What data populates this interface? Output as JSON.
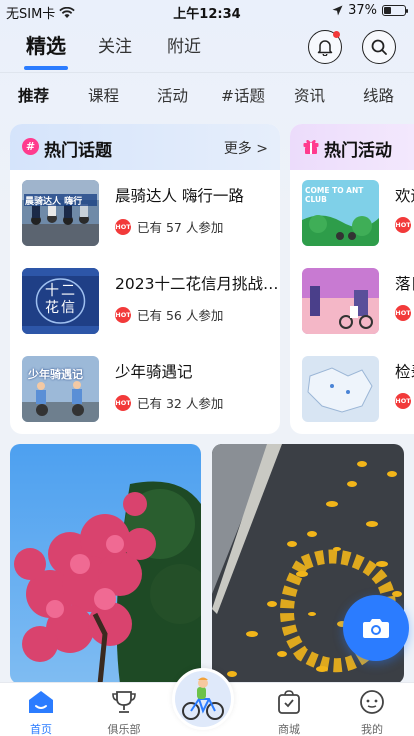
{
  "status_bar": {
    "carrier": "无SIM卡",
    "time": "上午12:34",
    "battery": "37%",
    "battery_level": 0.37
  },
  "header": {
    "tabs": [
      {
        "label": "精选",
        "active": true
      },
      {
        "label": "关注",
        "active": false
      },
      {
        "label": "附近",
        "active": false
      }
    ],
    "icons": [
      "bell-icon",
      "search-icon"
    ],
    "notification_dot": true
  },
  "subtabs": [
    {
      "label": "推荐",
      "active": true
    },
    {
      "label": "课程"
    },
    {
      "label": "活动"
    },
    {
      "label": "#话题"
    },
    {
      "label": "资讯"
    },
    {
      "label": "线路"
    }
  ],
  "hot_topics": {
    "title": "热门话题",
    "more": "更多 >",
    "items": [
      {
        "title": "晨骑达人 嗨行一路",
        "participants": "已有 57 人参加",
        "thumb_text": "晨骑达人 嗨行"
      },
      {
        "title": "2023十二花信月挑战…",
        "participants": "已有 56 人参加",
        "thumb_text": "十二 花信"
      },
      {
        "title": "少年骑遇记",
        "participants": "已有 32 人参加",
        "thumb_text": "少年骑遇记"
      }
    ]
  },
  "hot_activities": {
    "title": "热门活动",
    "items": [
      {
        "title": "欢迎",
        "thumb_text": "COME TO ANT CLUB"
      },
      {
        "title": "落日"
      },
      {
        "title": "检录"
      }
    ]
  },
  "hot_badge": "HOT",
  "bottom_nav": [
    {
      "label": "首页",
      "icon": "home-icon",
      "active": true
    },
    {
      "label": "俱乐部",
      "icon": "trophy-icon"
    },
    {
      "label": "",
      "icon": "cyclist-icon"
    },
    {
      "label": "商城",
      "icon": "shop-bag-icon"
    },
    {
      "label": "我的",
      "icon": "profile-icon"
    }
  ],
  "colors": {
    "accent": "#2b7cff",
    "hot": "#f23a3a",
    "topic_header": "#dfe9fb",
    "activity_header": "#efe1fb"
  }
}
